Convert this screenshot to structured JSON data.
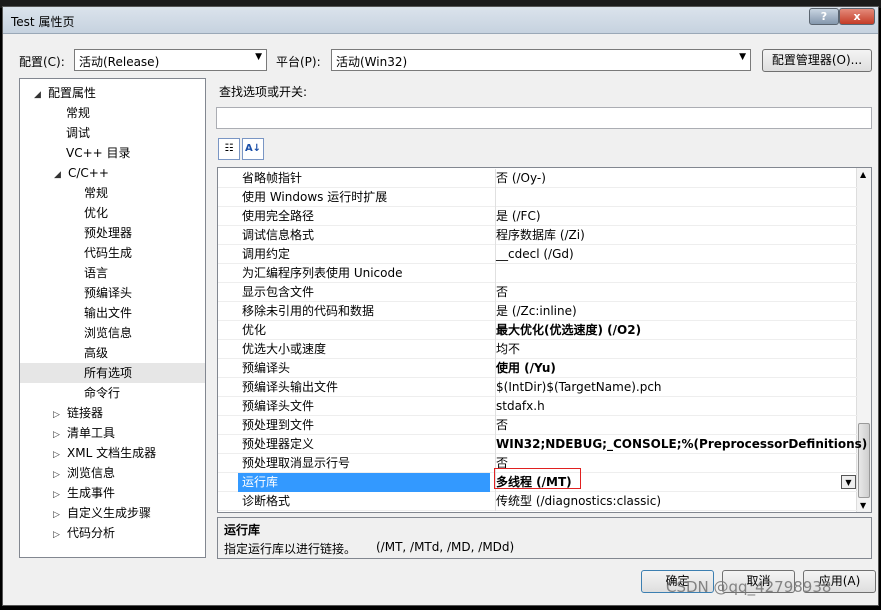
{
  "window": {
    "title": "Test 属性页",
    "help": "?",
    "close": "x"
  },
  "config": {
    "config_label": "配置(C):",
    "config_value": "活动(Release)",
    "platform_label": "平台(P):",
    "platform_value": "活动(Win32)",
    "manager_button": "配置管理器(O)..."
  },
  "tree": {
    "items": [
      {
        "label": "配置属性",
        "arrow": "◢"
      },
      {
        "label": "常规"
      },
      {
        "label": "调试"
      },
      {
        "label": "VC++ 目录"
      },
      {
        "label": "C/C++",
        "arrow": "◢"
      },
      {
        "label": "常规"
      },
      {
        "label": "优化"
      },
      {
        "label": "预处理器"
      },
      {
        "label": "代码生成"
      },
      {
        "label": "语言"
      },
      {
        "label": "预编译头"
      },
      {
        "label": "输出文件"
      },
      {
        "label": "浏览信息"
      },
      {
        "label": "高级"
      },
      {
        "label": "所有选项",
        "selected": true
      },
      {
        "label": "命令行"
      },
      {
        "label": "链接器",
        "arrow": "▷"
      },
      {
        "label": "清单工具",
        "arrow": "▷"
      },
      {
        "label": "XML 文档生成器",
        "arrow": "▷"
      },
      {
        "label": "浏览信息",
        "arrow": "▷"
      },
      {
        "label": "生成事件",
        "arrow": "▷"
      },
      {
        "label": "自定义生成步骤",
        "arrow": "▷"
      },
      {
        "label": "代码分析",
        "arrow": "▷"
      }
    ]
  },
  "search": {
    "label": "查找选项或开关:",
    "value": ""
  },
  "toolbar": {
    "categorized_icon": "categorized-icon",
    "sort_icon": "sort-az-icon"
  },
  "properties": [
    {
      "name": "省略帧指针",
      "value": "否 (/Oy-)"
    },
    {
      "name": "使用 Windows 运行时扩展",
      "value": ""
    },
    {
      "name": "使用完全路径",
      "value": "是 (/FC)"
    },
    {
      "name": "调试信息格式",
      "value": "程序数据库 (/Zi)"
    },
    {
      "name": "调用约定",
      "value": "__cdecl (/Gd)"
    },
    {
      "name": "为汇编程序列表使用 Unicode",
      "value": ""
    },
    {
      "name": "显示包含文件",
      "value": "否"
    },
    {
      "name": "移除未引用的代码和数据",
      "value": "是 (/Zc:inline)"
    },
    {
      "name": "优化",
      "value": "最大优化(优选速度) (/O2)",
      "bold": true
    },
    {
      "name": "优选大小或速度",
      "value": "均不"
    },
    {
      "name": "预编译头",
      "value": "使用 (/Yu)",
      "bold": true
    },
    {
      "name": "预编译头输出文件",
      "value": "$(IntDir)$(TargetName).pch"
    },
    {
      "name": "预编译头文件",
      "value": "stdafx.h"
    },
    {
      "name": "预处理到文件",
      "value": "否"
    },
    {
      "name": "预处理器定义",
      "value": "WIN32;NDEBUG;_CONSOLE;%(PreprocessorDefinitions)",
      "bold": true
    },
    {
      "name": "预处理取消显示行号",
      "value": "否"
    },
    {
      "name": "运行库",
      "value": "多线程 (/MT)",
      "bold": true,
      "selected": true
    },
    {
      "name": "诊断格式",
      "value": "传统型 (/diagnostics:classic)"
    }
  ],
  "description": {
    "title": "运行库",
    "text": "指定运行库以进行链接。",
    "switches": "(/MT, /MTd, /MD, /MDd)"
  },
  "buttons": {
    "ok": "确定",
    "cancel": "取消",
    "apply": "应用(A)"
  },
  "watermark": "CSDN @qq_42798938"
}
